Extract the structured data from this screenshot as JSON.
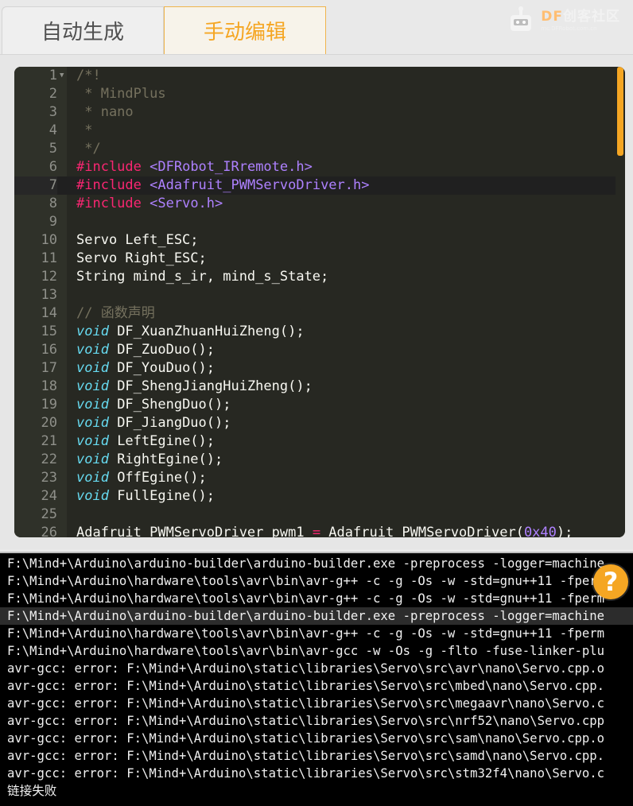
{
  "tabs": [
    {
      "label": "自动生成",
      "active": false
    },
    {
      "label": "手动编辑",
      "active": true
    }
  ],
  "brand": {
    "prefix": "DF",
    "name": "创客社区",
    "url": "mc.DFRobot.com.cn"
  },
  "editor": {
    "active_line": 7,
    "lines": [
      {
        "n": "1",
        "fold": true,
        "tokens": [
          {
            "c": "t-comment",
            "t": "/*!"
          }
        ]
      },
      {
        "n": "2",
        "tokens": [
          {
            "c": "t-comment",
            "t": " * MindPlus"
          }
        ]
      },
      {
        "n": "3",
        "tokens": [
          {
            "c": "t-comment",
            "t": " * nano"
          }
        ]
      },
      {
        "n": "4",
        "tokens": [
          {
            "c": "t-comment",
            "t": " *"
          }
        ]
      },
      {
        "n": "5",
        "tokens": [
          {
            "c": "t-comment",
            "t": " */"
          }
        ]
      },
      {
        "n": "6",
        "tokens": [
          {
            "c": "t-kw",
            "t": "#include"
          },
          {
            "c": "t-plain",
            "t": " "
          },
          {
            "c": "t-str",
            "t": "<DFRobot_IRremote.h>"
          }
        ]
      },
      {
        "n": "7",
        "tokens": [
          {
            "c": "t-kw",
            "t": "#include"
          },
          {
            "c": "t-plain",
            "t": " "
          },
          {
            "c": "t-str",
            "t": "<Adafruit_PWMServoDriver.h>"
          }
        ]
      },
      {
        "n": "8",
        "tokens": [
          {
            "c": "t-kw",
            "t": "#include"
          },
          {
            "c": "t-plain",
            "t": " "
          },
          {
            "c": "t-str",
            "t": "<Servo.h>"
          }
        ]
      },
      {
        "n": "9",
        "tokens": []
      },
      {
        "n": "10",
        "tokens": [
          {
            "c": "t-plain",
            "t": "Servo Left_ESC;"
          }
        ]
      },
      {
        "n": "11",
        "tokens": [
          {
            "c": "t-plain",
            "t": "Servo Right_ESC;"
          }
        ]
      },
      {
        "n": "12",
        "tokens": [
          {
            "c": "t-plain",
            "t": "String mind_s_ir, mind_s_State;"
          }
        ]
      },
      {
        "n": "13",
        "tokens": []
      },
      {
        "n": "14",
        "tokens": [
          {
            "c": "t-comment",
            "t": "// 函数声明"
          }
        ]
      },
      {
        "n": "15",
        "tokens": [
          {
            "c": "t-type",
            "t": "void"
          },
          {
            "c": "t-plain",
            "t": " DF_XuanZhuanHuiZheng();"
          }
        ]
      },
      {
        "n": "16",
        "tokens": [
          {
            "c": "t-type",
            "t": "void"
          },
          {
            "c": "t-plain",
            "t": " DF_ZuoDuo();"
          }
        ]
      },
      {
        "n": "17",
        "tokens": [
          {
            "c": "t-type",
            "t": "void"
          },
          {
            "c": "t-plain",
            "t": " DF_YouDuo();"
          }
        ]
      },
      {
        "n": "18",
        "tokens": [
          {
            "c": "t-type",
            "t": "void"
          },
          {
            "c": "t-plain",
            "t": " DF_ShengJiangHuiZheng();"
          }
        ]
      },
      {
        "n": "19",
        "tokens": [
          {
            "c": "t-type",
            "t": "void"
          },
          {
            "c": "t-plain",
            "t": " DF_ShengDuo();"
          }
        ]
      },
      {
        "n": "20",
        "tokens": [
          {
            "c": "t-type",
            "t": "void"
          },
          {
            "c": "t-plain",
            "t": " DF_JiangDuo();"
          }
        ]
      },
      {
        "n": "21",
        "tokens": [
          {
            "c": "t-type",
            "t": "void"
          },
          {
            "c": "t-plain",
            "t": " LeftEgine();"
          }
        ]
      },
      {
        "n": "22",
        "tokens": [
          {
            "c": "t-type",
            "t": "void"
          },
          {
            "c": "t-plain",
            "t": " RightEgine();"
          }
        ]
      },
      {
        "n": "23",
        "tokens": [
          {
            "c": "t-type",
            "t": "void"
          },
          {
            "c": "t-plain",
            "t": " OffEgine();"
          }
        ]
      },
      {
        "n": "24",
        "tokens": [
          {
            "c": "t-type",
            "t": "void"
          },
          {
            "c": "t-plain",
            "t": " FullEgine();"
          }
        ]
      },
      {
        "n": "25",
        "tokens": []
      },
      {
        "n": "26",
        "tokens": [
          {
            "c": "t-plain",
            "t": "Adafruit_PWMServoDriver pwm1 "
          },
          {
            "c": "t-kw",
            "t": "="
          },
          {
            "c": "t-plain",
            "t": " Adafruit_PWMServoDriver("
          },
          {
            "c": "t-num",
            "t": "0x40"
          },
          {
            "c": "t-plain",
            "t": ");"
          }
        ]
      }
    ]
  },
  "console": {
    "highlight_line": 4,
    "lines": [
      "F:\\Mind+\\Arduino\\arduino-builder\\arduino-builder.exe -preprocess -logger=machine",
      "F:\\Mind+\\Arduino\\hardware\\tools\\avr\\bin\\avr-g++ -c -g -Os -w -std=gnu++11 -fperm",
      "F:\\Mind+\\Arduino\\hardware\\tools\\avr\\bin\\avr-g++ -c -g -Os -w -std=gnu++11 -fperm",
      "F:\\Mind+\\Arduino\\arduino-builder\\arduino-builder.exe -preprocess -logger=machine",
      "F:\\Mind+\\Arduino\\hardware\\tools\\avr\\bin\\avr-g++ -c -g -Os -w -std=gnu++11 -fperm",
      "F:\\Mind+\\Arduino\\hardware\\tools\\avr\\bin\\avr-gcc -w -Os -g -flto -fuse-linker-plu",
      "avr-gcc: error: F:\\Mind+\\Arduino\\static\\libraries\\Servo\\src\\avr\\nano\\Servo.cpp.o",
      "avr-gcc: error: F:\\Mind+\\Arduino\\static\\libraries\\Servo\\src\\mbed\\nano\\Servo.cpp.",
      "avr-gcc: error: F:\\Mind+\\Arduino\\static\\libraries\\Servo\\src\\megaavr\\nano\\Servo.c",
      "avr-gcc: error: F:\\Mind+\\Arduino\\static\\libraries\\Servo\\src\\nrf52\\nano\\Servo.cpp",
      "avr-gcc: error: F:\\Mind+\\Arduino\\static\\libraries\\Servo\\src\\sam\\nano\\Servo.cpp.o",
      "avr-gcc: error: F:\\Mind+\\Arduino\\static\\libraries\\Servo\\src\\samd\\nano\\Servo.cpp.",
      "avr-gcc: error: F:\\Mind+\\Arduino\\static\\libraries\\Servo\\src\\stm32f4\\nano\\Servo.c",
      "链接失败"
    ]
  },
  "help_button": {
    "label": "?"
  }
}
